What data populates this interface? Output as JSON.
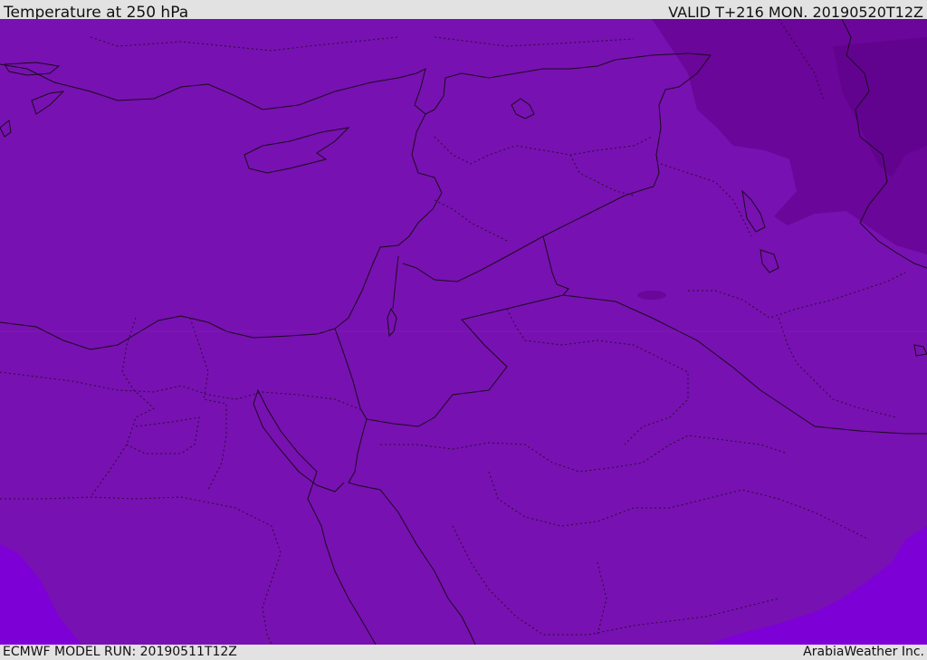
{
  "header": {
    "title": "Temperature at 250 hPa",
    "valid": "VALID T+216 MON. 20190520T12Z"
  },
  "footer": {
    "model_run": "ECMWF MODEL RUN: 20190511T12Z",
    "credit": "ArabiaWeather Inc."
  },
  "map": {
    "colors": {
      "base_fill": "#7811b1",
      "cold_region": "#6a0699",
      "coldest_region": "#62038f",
      "warm_region": "#7d00d6",
      "border_solid": "#1a0a1e",
      "border_dotted": "#2a0a35"
    }
  }
}
